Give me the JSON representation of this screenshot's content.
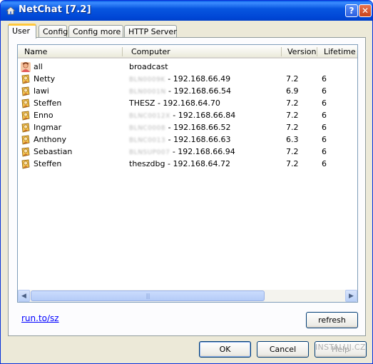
{
  "window": {
    "title": "NetChat [7.2]",
    "help_button": "?",
    "close_button": "✕"
  },
  "tabs": [
    {
      "label": "User",
      "active": true
    },
    {
      "label": "Config",
      "active": false
    },
    {
      "label": "Config more",
      "active": false
    },
    {
      "label": "HTTP Server",
      "active": false
    }
  ],
  "list": {
    "columns": {
      "name": "Name",
      "computer": "Computer",
      "version": "Version",
      "lifetime": "Lifetime"
    },
    "rows": [
      {
        "icon": "all-users-icon",
        "name": "all",
        "host": "",
        "ip": "broadcast",
        "version": "",
        "lifetime": ""
      },
      {
        "icon": "user-icon",
        "name": "Netty",
        "host": "BLN0009K",
        "ip": " - 192.168.66.49",
        "version": "7.2",
        "lifetime": "6"
      },
      {
        "icon": "user-icon",
        "name": "lawi",
        "host": "BLN0001N",
        "ip": " - 192.168.66.54",
        "version": "6.9",
        "lifetime": "6"
      },
      {
        "icon": "user-icon",
        "name": "Steffen",
        "host": "",
        "ip": "THESZ - 192.168.64.70",
        "version": "7.2",
        "lifetime": "6"
      },
      {
        "icon": "user-icon",
        "name": "Enno",
        "host": "BLNC0012X",
        "ip": " - 192.168.66.84",
        "version": "7.2",
        "lifetime": "6"
      },
      {
        "icon": "user-icon",
        "name": "Ingmar",
        "host": "BLNC0008",
        "ip": " - 192.168.66.52",
        "version": "7.2",
        "lifetime": "6"
      },
      {
        "icon": "user-icon",
        "name": "Anthony",
        "host": "BLNC0013",
        "ip": " - 192.168.66.63",
        "version": "6.3",
        "lifetime": "6"
      },
      {
        "icon": "user-icon",
        "name": "Sebastian",
        "host": "BLNSUP007",
        "ip": " - 192.168.66.94",
        "version": "7.2",
        "lifetime": "6"
      },
      {
        "icon": "user-icon",
        "name": "Steffen",
        "host": "",
        "ip": "theszdbg - 192.168.64.72",
        "version": "7.2",
        "lifetime": "6"
      }
    ]
  },
  "link": "run.to/sz",
  "buttons": {
    "refresh": "refresh",
    "ok": "OK",
    "cancel": "Cancel",
    "help": "Help"
  },
  "watermark": "INSTALUJ.CZ",
  "colors": {
    "titlebar": "#0046d5",
    "tab_accent": "#ffc83c",
    "link": "#0000ff"
  }
}
